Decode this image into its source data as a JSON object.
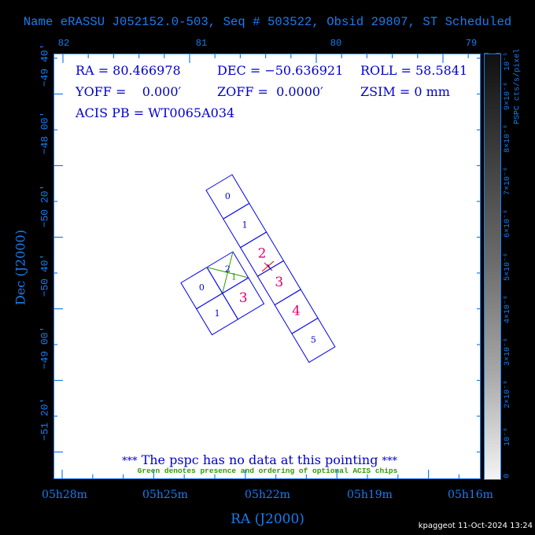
{
  "title": "Name eRASSU J052152.0-503, Seq # 503522, Obsid 29807, ST Scheduled",
  "top_axis_ticks": [
    "82",
    "81",
    "80",
    "79"
  ],
  "left_axis_ticks": [
    "−49 40′",
    "−48 00′",
    "−50 20′",
    "−50 40′",
    "−49 00′",
    "−51 20′"
  ],
  "bottom_axis_ticks": [
    "05h28m",
    "05h25m",
    "05h22m",
    "05h19m",
    "05h16m"
  ],
  "x_axis_title": "RA (J2000)",
  "y_axis_title": "Dec (J2000)",
  "info": {
    "ra": "RA = 80.466978",
    "dec": "DEC = −50.636921",
    "roll": "ROLL = 58.5841",
    "yoff": "YOFF =    0.000′",
    "zoff": "ZOFF =  0.0000′",
    "zsim": "ZSIM = 0 mm",
    "acis_pb": "ACIS PB = WT0065A034"
  },
  "no_data_message": {
    "stars_left": "***",
    "text": " The pspc has no data at this pointing ",
    "stars_right": "***"
  },
  "green_note": "Green denotes presence and ordering of optional ACIS chips",
  "colorbar": {
    "title": "PSPC cts/s/pixel",
    "labels": [
      "10⁻⁵",
      "9×10⁻⁶",
      "8×10⁻⁶",
      "7×10⁻⁶",
      "6×10⁻⁶",
      "5×10⁻⁶",
      "4×10⁻⁶",
      "3×10⁻⁶",
      "2×10⁻⁶",
      "10⁻⁶",
      "0"
    ]
  },
  "chips": {
    "s_array": [
      {
        "label": "0",
        "active": false
      },
      {
        "label": "1",
        "active": false
      },
      {
        "label": "2",
        "active": true
      },
      {
        "label": "3",
        "active": true
      },
      {
        "label": "4",
        "active": true
      },
      {
        "label": "5",
        "active": false
      }
    ],
    "i_array": [
      {
        "label": "0",
        "active": false
      },
      {
        "label": "1",
        "active": false
      },
      {
        "label": "2",
        "active": false,
        "optional": true,
        "optional_order": "1"
      },
      {
        "label": "3",
        "active": true
      }
    ],
    "colors": {
      "outline": "#0000ee",
      "inactive_label": "#0000cc",
      "active_label": "#e8006a",
      "optional": "#2e9a00",
      "aimpoint": "#e00000"
    }
  },
  "footer": "kpaggeot 11-Oct-2024 13:24",
  "colors": {
    "axis": "#1a7cf0",
    "background": "#000000",
    "plot_bg": "#ffffff"
  }
}
